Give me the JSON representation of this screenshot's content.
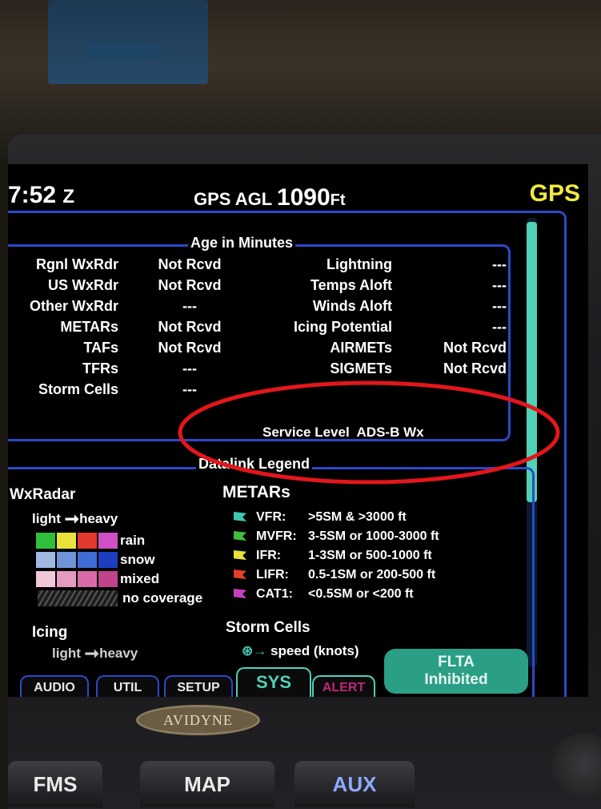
{
  "header": {
    "time": "7:52",
    "time_zone": "Z",
    "agl_prefix": "GPS AGL",
    "agl_value": "1090",
    "agl_unit": "Ft",
    "nav_source": "GPS"
  },
  "age_section": {
    "title": "Age in Minutes",
    "left_rows": [
      {
        "label": "Rgnl WxRdr",
        "value": "Not Rcvd"
      },
      {
        "label": "US WxRdr",
        "value": "Not Rcvd"
      },
      {
        "label": "Other WxRdr",
        "value": "---"
      },
      {
        "label": "METARs",
        "value": "Not Rcvd"
      },
      {
        "label": "TAFs",
        "value": "Not Rcvd"
      },
      {
        "label": "TFRs",
        "value": "---"
      },
      {
        "label": "Storm Cells",
        "value": "---"
      }
    ],
    "right_rows": [
      {
        "label": "Lightning",
        "value": "---"
      },
      {
        "label": "Temps Aloft",
        "value": "---"
      },
      {
        "label": "Winds Aloft",
        "value": "---"
      },
      {
        "label": "Icing Potential",
        "value": "---"
      },
      {
        "label": "AIRMETs",
        "value": "Not Rcvd"
      },
      {
        "label": "SIGMETs",
        "value": "Not Rcvd"
      }
    ],
    "service_level_label": "Service Level",
    "service_level_value": "ADS-B Wx"
  },
  "legend_section": {
    "title": "Datalink Legend",
    "wxradar": {
      "heading": "WxRadar",
      "scale_light": "light",
      "scale_heavy": "heavy",
      "rows": [
        {
          "label": "rain",
          "colors": [
            "#2fbf3a",
            "#e7e33a",
            "#e23a2c",
            "#d04fc4"
          ]
        },
        {
          "label": "snow",
          "colors": [
            "#9fb9e3",
            "#6f95d8",
            "#3f6cd5",
            "#1c3fc0"
          ]
        },
        {
          "label": "mixed",
          "colors": [
            "#f0c8d8",
            "#e59ac0",
            "#d86ba7",
            "#c0438c"
          ]
        },
        {
          "label": "no coverage"
        }
      ]
    },
    "metars": {
      "heading": "METARs",
      "rows": [
        {
          "label": "VFR:",
          "desc": ">5SM & >3000 ft",
          "color": "#3fc4b0"
        },
        {
          "label": "MVFR:",
          "desc": "3-5SM or 1000-3000 ft",
          "color": "#3fbf3a"
        },
        {
          "label": "IFR:",
          "desc": "1-3SM or 500-1000 ft",
          "color": "#e8e23a"
        },
        {
          "label": "LIFR:",
          "desc": "0.5-1SM or 200-500 ft",
          "color": "#e2402c"
        },
        {
          "label": "CAT1:",
          "desc": "<0.5SM or <200 ft",
          "color": "#c33fc1"
        }
      ]
    },
    "icing": {
      "heading": "Icing",
      "scale_light": "light",
      "scale_heavy": "heavy"
    },
    "storm_cells": {
      "heading": "Storm Cells",
      "speed_text": "speed (knots)"
    }
  },
  "tabs": [
    "AUDIO",
    "UTIL",
    "SETUP",
    "SYS",
    "ALERT"
  ],
  "flta": {
    "line1": "FLTA",
    "line2": "Inhibited"
  },
  "hardware": {
    "logo": "AVIDYNE",
    "buttons": [
      "FMS",
      "MAP",
      "AUX"
    ]
  }
}
